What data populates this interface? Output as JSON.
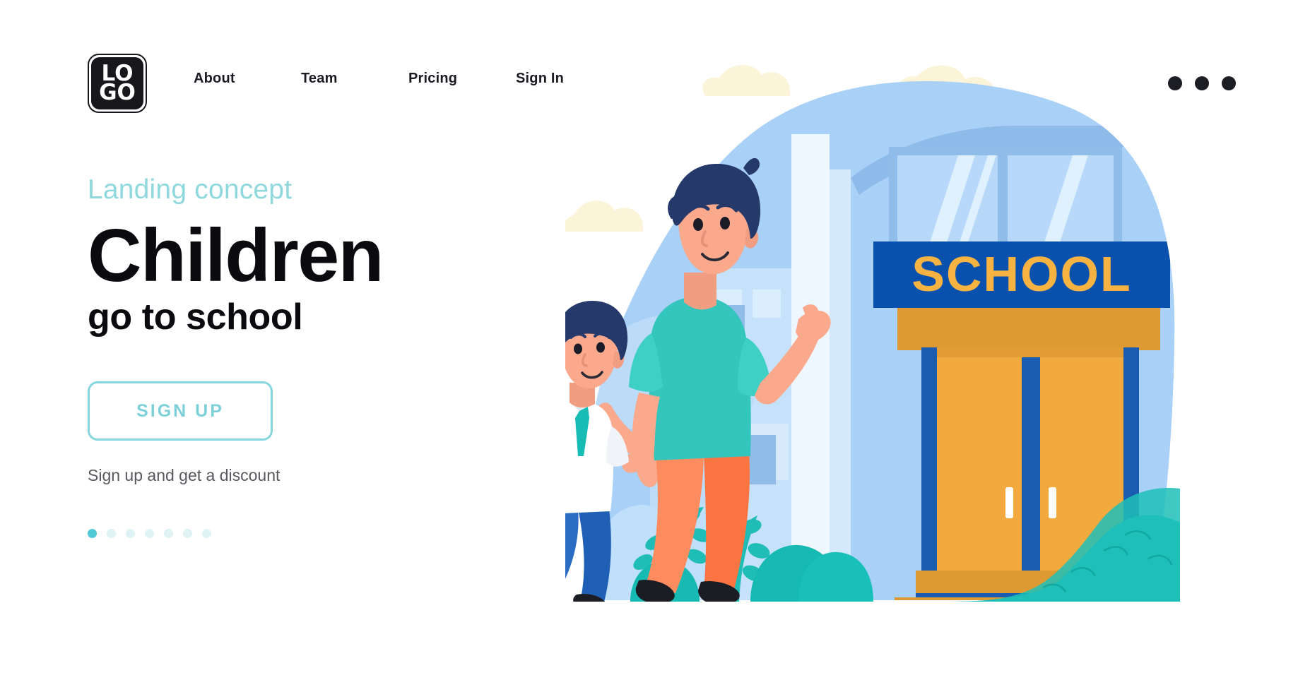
{
  "header": {
    "logo": {
      "line1": "LO",
      "line2": "GO",
      "name": "LOGO"
    },
    "nav": [
      {
        "label": "About"
      },
      {
        "label": "Team"
      },
      {
        "label": "Pricing"
      },
      {
        "label": "Sign In"
      }
    ],
    "menu_icon": "three-dots-icon"
  },
  "hero": {
    "eyebrow": "Landing concept",
    "headline": "Children",
    "subheadline": "go to school",
    "cta_label": "SIGN UP",
    "cta_note": "Sign up and get a discount",
    "carousel": {
      "total": 7,
      "active_index": 0
    }
  },
  "illustration": {
    "school_sign": "SCHOOL",
    "alt": "Father walking a schoolboy to the school entrance"
  },
  "colors": {
    "accent_teal": "#85d6dd",
    "accent_teal_active": "#4fc9d3",
    "text_dark": "#0b0b0f",
    "text_muted": "#58585e",
    "sign_blue": "#0a50ad",
    "sign_text": "#f5b342",
    "door_orange": "#f0a83c",
    "door_frame_blue": "#1a5cb0",
    "sky_blue": "#a8cff5",
    "cloud_cream": "#fbf3d5",
    "shirt_teal": "#34c6bd",
    "pants_orange": "#fa7542",
    "boy_pants_blue": "#1f5fb5",
    "bag_yellow": "#f0b53d",
    "bush_teal": "#17b8b0",
    "hair_navy": "#253a6b",
    "skin": "#fba98c"
  }
}
